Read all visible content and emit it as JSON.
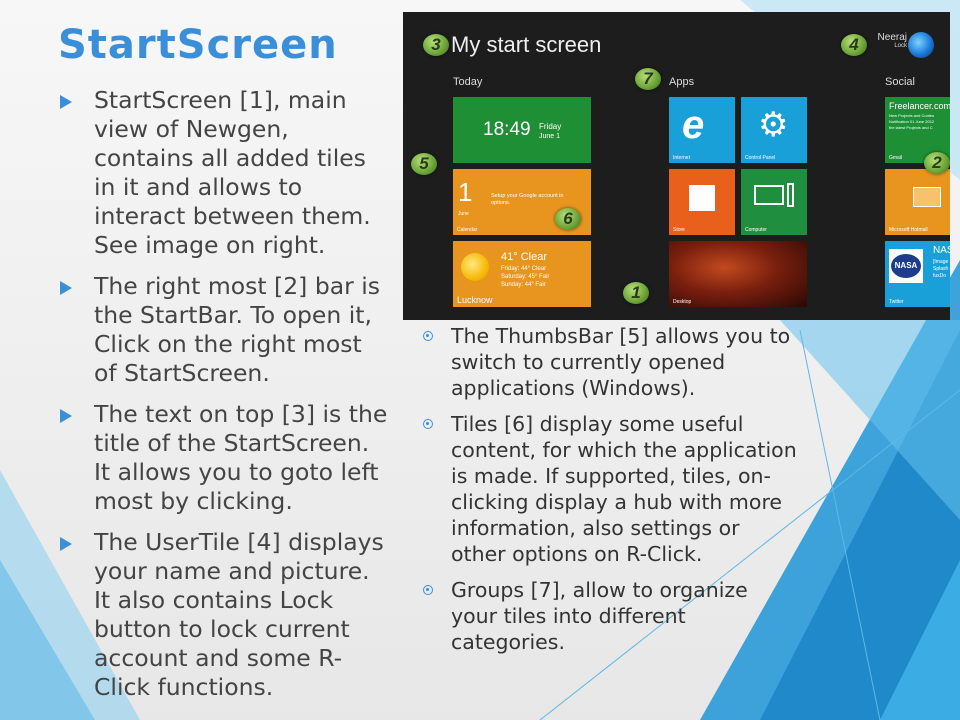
{
  "slide": {
    "title": "StartScreen",
    "left_bullets": [
      "StartScreen [1], main view of Newgen, contains all added tiles in it and allows to interact between them. See image on right.",
      "The right most [2] bar is the StartBar. To open it, Click on the right most of StartScreen.",
      "The text on top [3] is the title of  the StartScreen. It allows you to goto left most by clicking.",
      "The UserTile [4] displays your name and picture. It also contains Lock button to lock current account and some R-Click functions."
    ],
    "right_bullets": [
      "The ThumbsBar [5] allows you to switch to currently opened applications (Windows).",
      "Tiles [6] display some useful content, for which the application is made. If supported, tiles, on-clicking display a hub with more information, also settings or other options on R-Click.",
      "Groups [7], allow to organize your tiles into different categories."
    ]
  },
  "screenshot": {
    "title": "My start screen",
    "user_name": "Neeraj",
    "user_lock": "Lock",
    "groups": {
      "today": "Today",
      "apps": "Apps",
      "social": "Social"
    },
    "clock": {
      "time": "18:49",
      "day": "Friday",
      "date": "June 1"
    },
    "calendar": {
      "day_num": "1",
      "month": "June",
      "label": "Calendar",
      "message": "Setup your Google account in options."
    },
    "weather": {
      "current": "41° Clear",
      "lines": [
        "Friday: 44° Clear",
        "Saturday: 45° Fair",
        "Sunday: 44° Fair"
      ],
      "city": "Lucknow"
    },
    "apps": {
      "internet": "Internet",
      "control_panel": "Control Panel",
      "store": "Store",
      "computer": "Computer",
      "desktop": "Desktop"
    },
    "social": {
      "gmail_title": "Freelancer.com",
      "gmail_lines": [
        "New Projects and Contes",
        "Notification 01 June 2012",
        "the latest Projects and C"
      ],
      "gmail_label": "Gmail",
      "hotmail_label": "Microsoft Hotmail",
      "twitter_head": "NAS",
      "twitter_lines": [
        "[Image",
        "Splash",
        "fuxDo"
      ],
      "twitter_label": "Twitter",
      "nasa_logo": "NASA"
    },
    "badges": [
      "1",
      "2",
      "3",
      "4",
      "5",
      "6",
      "7",
      "1"
    ],
    "colors": {
      "green": "#1f8f36",
      "orange": "#e8951f",
      "blue": "#1aa0d8",
      "store_orange": "#e8601b",
      "computer_green": "#1f8f3f",
      "hotmail": "#e8951f"
    }
  }
}
